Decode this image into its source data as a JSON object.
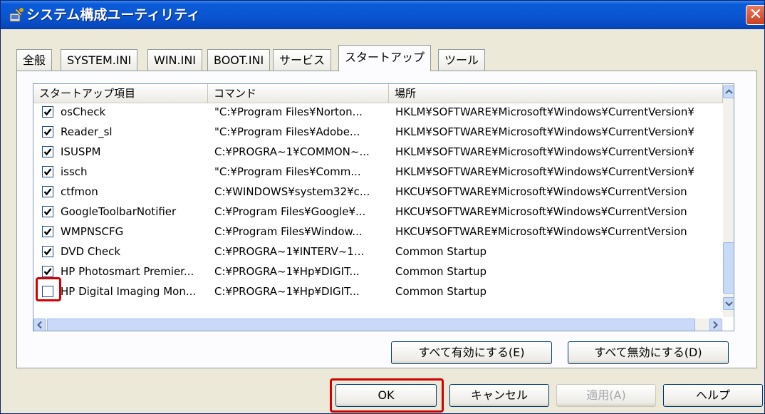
{
  "window": {
    "title": "システム構成ユーティリティ",
    "close_glyph": "✕"
  },
  "tabs": [
    {
      "label": "全般"
    },
    {
      "label": "SYSTEM.INI"
    },
    {
      "label": "WIN.INI"
    },
    {
      "label": "BOOT.INI"
    },
    {
      "label": "サービス"
    },
    {
      "label": "スタートアップ",
      "active": true
    },
    {
      "label": "ツール"
    }
  ],
  "startup_list": {
    "columns": [
      "スタートアップ項目",
      "コマンド",
      "場所"
    ],
    "rows": [
      {
        "checked": true,
        "item": "osCheck",
        "command": "\"C:¥Program Files¥Norton...",
        "location": "HKLM¥SOFTWARE¥Microsoft¥Windows¥CurrentVersion¥"
      },
      {
        "checked": true,
        "item": "Reader_sl",
        "command": "\"C:¥Program Files¥Adobe...",
        "location": "HKLM¥SOFTWARE¥Microsoft¥Windows¥CurrentVersion¥"
      },
      {
        "checked": true,
        "item": "ISUSPM",
        "command": "C:¥PROGRA~1¥COMMON~...",
        "location": "HKLM¥SOFTWARE¥Microsoft¥Windows¥CurrentVersion¥"
      },
      {
        "checked": true,
        "item": "issch",
        "command": "\"C:¥Program Files¥Comm...",
        "location": "HKLM¥SOFTWARE¥Microsoft¥Windows¥CurrentVersion¥"
      },
      {
        "checked": true,
        "item": "ctfmon",
        "command": "C:¥WINDOWS¥system32¥c...",
        "location": "HKCU¥SOFTWARE¥Microsoft¥Windows¥CurrentVersion"
      },
      {
        "checked": true,
        "item": "GoogleToolbarNotifier",
        "command": "C:¥Program Files¥Google¥...",
        "location": "HKCU¥SOFTWARE¥Microsoft¥Windows¥CurrentVersion"
      },
      {
        "checked": true,
        "item": "WMPNSCFG",
        "command": "C:¥Program Files¥Window...",
        "location": "HKCU¥SOFTWARE¥Microsoft¥Windows¥CurrentVersion"
      },
      {
        "checked": true,
        "item": "DVD Check",
        "command": "C:¥PROGRA~1¥INTERV~1...",
        "location": "Common Startup"
      },
      {
        "checked": true,
        "item": "HP Photosmart Premier...",
        "command": "C:¥PROGRA~1¥Hp¥DIGIT...",
        "location": "Common Startup"
      },
      {
        "checked": false,
        "item": "HP Digital Imaging Mon...",
        "command": "C:¥PROGRA~1¥Hp¥DIGIT...",
        "location": "Common Startup"
      }
    ]
  },
  "buttons": {
    "enable_all": "すべて有効にする(E)",
    "disable_all": "すべて無効にする(D)",
    "ok": "OK",
    "cancel": "キャンセル",
    "apply": "適用(A)",
    "help": "ヘルプ"
  },
  "highlight_color": "#d20000",
  "titlebar_color": "#0a54d0",
  "icons": [
    "msconfig-icon",
    "close-icon",
    "checkbox-checked-icon",
    "checkbox-unchecked-icon",
    "scroll-up-icon",
    "scroll-down-icon",
    "scroll-left-icon",
    "scroll-right-icon"
  ]
}
